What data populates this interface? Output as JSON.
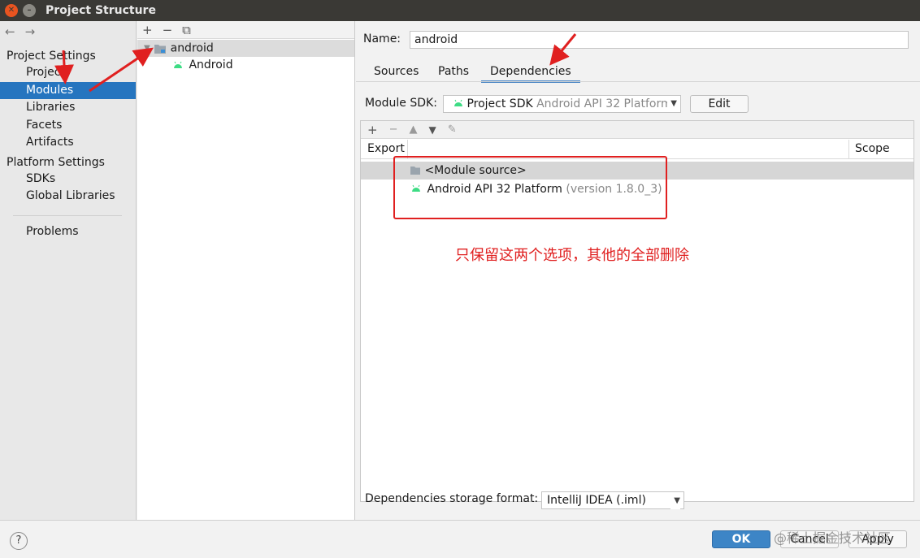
{
  "window": {
    "title": "Project Structure"
  },
  "sidebar": {
    "project_settings_header": "Project Settings",
    "platform_settings_header": "Platform Settings",
    "items": [
      {
        "label": "Project"
      },
      {
        "label": "Modules"
      },
      {
        "label": "Libraries"
      },
      {
        "label": "Facets"
      },
      {
        "label": "Artifacts"
      },
      {
        "label": "SDKs"
      },
      {
        "label": "Global Libraries"
      },
      {
        "label": "Problems"
      }
    ]
  },
  "tree": {
    "toolbar": [
      "+",
      "−",
      "⧉"
    ],
    "module": "android",
    "facet": "Android"
  },
  "module": {
    "name_label": "Name:",
    "name_value": "android",
    "tabs": [
      "Sources",
      "Paths",
      "Dependencies"
    ],
    "sdk_label": "Module SDK:",
    "sdk_value": "Project SDK",
    "sdk_value_detail": "Android API 32 Platform",
    "edit_button": "Edit",
    "dep_toolbar": [
      "+",
      "−",
      "▲",
      "▼",
      "✎"
    ],
    "columns": {
      "export": "Export",
      "scope": "Scope"
    },
    "dependencies": [
      {
        "label": "<Module source>",
        "version": ""
      },
      {
        "label": "Android API 32 Platform",
        "version": "(version 1.8.0_3)"
      }
    ],
    "storage_label": "Dependencies storage format:",
    "storage_value": "IntelliJ IDEA (.iml)"
  },
  "footer": {
    "help": "?",
    "ok": "OK",
    "cancel": "Cancel",
    "apply": "Apply",
    "watermark": "@稀土掘金技术社区"
  },
  "annotation": {
    "note": "只保留这两个选项，其他的全部删除",
    "color": "#e02020"
  },
  "colors": {
    "selection": "#2675bf",
    "android_green": "#3ddc84",
    "ok_button": "#3d85c6"
  }
}
